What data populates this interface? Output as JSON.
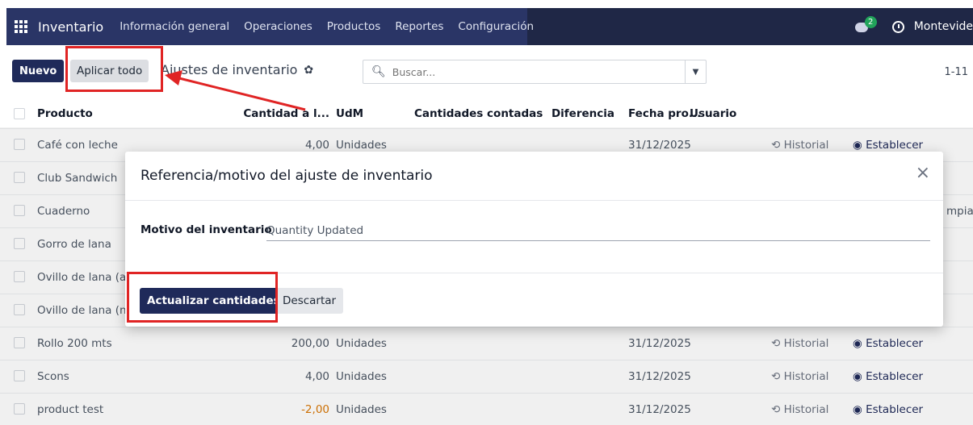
{
  "navbar": {
    "app_name": "Inventario",
    "menu": [
      "Información general",
      "Operaciones",
      "Productos",
      "Reportes",
      "Configuración"
    ],
    "chat_badge": "2",
    "company": "Montevide"
  },
  "controls": {
    "new_label": "Nuevo",
    "apply_all_label": "Aplicar todo",
    "breadcrumb": "Ajustes de inventario",
    "search_placeholder": "Buscar...",
    "pager": "1-11"
  },
  "table": {
    "headers": {
      "product": "Producto",
      "qty": "Cantidad a l...",
      "udm": "UdM",
      "counted": "Cantidades contadas",
      "diff": "Diferencia",
      "date": "Fecha pro...",
      "user": "Usuario"
    },
    "rows": [
      {
        "product": "Café con leche",
        "qty": "4,00",
        "udm": "Unidades",
        "date": "31/12/2025",
        "history": "Historial",
        "set": "Establecer"
      },
      {
        "product": "Club Sandwich"
      },
      {
        "product": "Cuaderno",
        "extra": "mpiar"
      },
      {
        "product": "Gorro de lana"
      },
      {
        "product": "Ovillo de lana (az"
      },
      {
        "product": "Ovillo de lana (na"
      },
      {
        "product": "Rollo 200 mts",
        "qty": "200,00",
        "udm": "Unidades",
        "date": "31/12/2025",
        "history": "Historial",
        "set": "Establecer"
      },
      {
        "product": "Scons",
        "qty": "4,00",
        "udm": "Unidades",
        "date": "31/12/2025",
        "history": "Historial",
        "set": "Establecer"
      },
      {
        "product": "product test",
        "qty": "-2,00",
        "udm": "Unidades",
        "date": "31/12/2025",
        "history": "Historial",
        "set": "Establecer"
      }
    ]
  },
  "modal": {
    "title": "Referencia/motivo del ajuste de inventario",
    "field_label": "Motivo del inventario",
    "field_value": "Quantity Updated",
    "update_label": "Actualizar cantidades",
    "discard_label": "Descartar"
  },
  "colors": {
    "navbar": "#1f2746",
    "primary": "#1f2a5a",
    "annotation": "#e02424",
    "negative": "#d97706"
  }
}
